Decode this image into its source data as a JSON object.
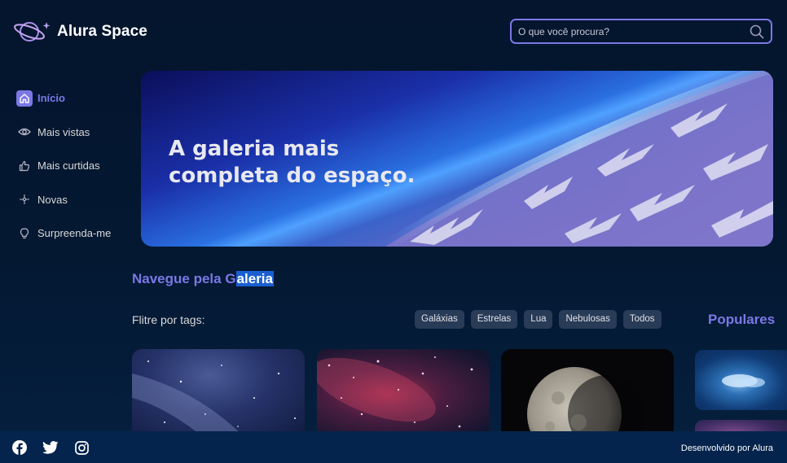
{
  "header": {
    "brand": "Alura Space",
    "search_placeholder": "O que você procura?"
  },
  "sidebar": {
    "items": [
      {
        "label": "Início",
        "icon": "home-icon",
        "active": true
      },
      {
        "label": "Mais vistas",
        "icon": "eye-icon"
      },
      {
        "label": "Mais curtidas",
        "icon": "thumbs-up-icon"
      },
      {
        "label": "Novas",
        "icon": "sparkle-icon"
      },
      {
        "label": "Surpreenda-me",
        "icon": "lightbulb-icon"
      }
    ]
  },
  "banner": {
    "line1": "A galeria mais",
    "line2": "completa do espaço."
  },
  "gallery": {
    "heading_prefix": "Navegue pela G",
    "heading_selected": "aleria",
    "filter_label": "Flitre por tags:",
    "tags": [
      "Galáxias",
      "Estrelas",
      "Lua",
      "Nebulosas",
      "Todos"
    ],
    "popular_heading": "Populares"
  },
  "footer": {
    "credit": "Desenvolvido por Alura",
    "social": [
      "facebook-icon",
      "twitter-icon",
      "instagram-icon"
    ]
  },
  "colors": {
    "accent": "#7b78e5",
    "background": "#04152d",
    "footer": "#04244d",
    "tag_bg": "#283b57"
  }
}
